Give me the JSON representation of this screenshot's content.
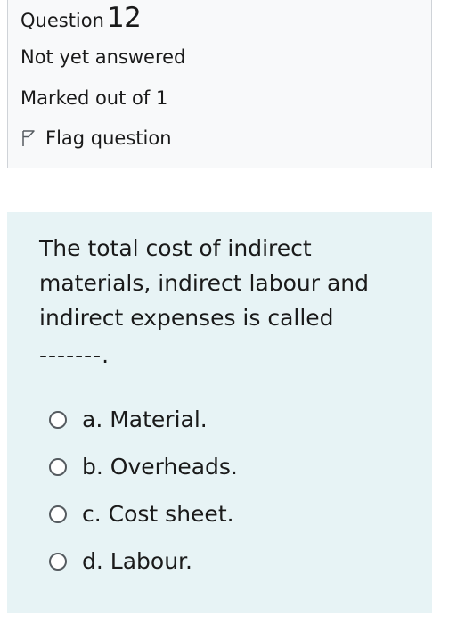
{
  "question_info": {
    "label": "Question",
    "number": "12",
    "state": "Not yet answered",
    "grade": "Marked out of 1",
    "flag_label": "Flag question"
  },
  "question": {
    "text": "The total cost of indirect materials, indirect labour and indirect expenses is called",
    "blank": "-------."
  },
  "answers": [
    {
      "prefix": "a.",
      "text": "Material."
    },
    {
      "prefix": "b.",
      "text": "Overheads."
    },
    {
      "prefix": "c.",
      "text": "Cost sheet."
    },
    {
      "prefix": "d.",
      "text": "Labour."
    }
  ],
  "colors": {
    "info_bg": "#f8f9fa",
    "formulation_bg": "#e7f3f5"
  },
  "icons": {
    "flag": "flag-outline-icon",
    "radio": "radio-unchecked-icon"
  }
}
